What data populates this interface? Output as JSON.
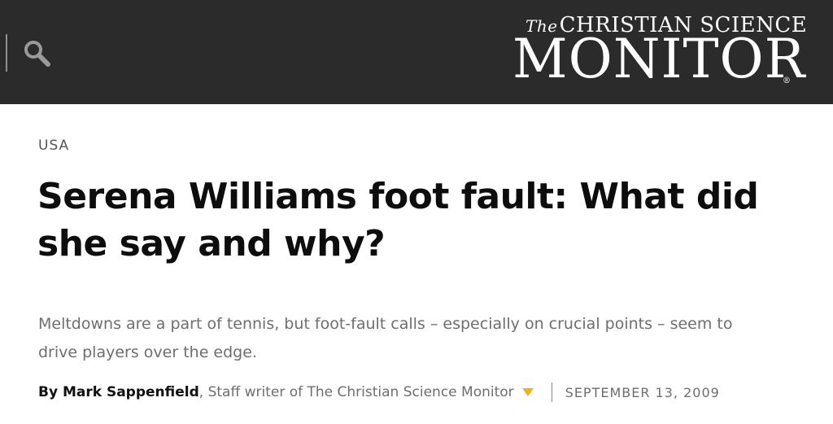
{
  "header": {
    "search_icon": "search-icon",
    "logo_the": "The",
    "logo_top": "CHRISTIAN SCIENCE",
    "logo_main": "MONITOR",
    "logo_reg": "®"
  },
  "article": {
    "section": "USA",
    "headline": "Serena Williams foot fault: What did she say and why?",
    "summary": "Meltdowns are a part of tennis, but foot-fault calls – especially on crucial points – seem to drive players over the edge.",
    "byline": {
      "by": "By Mark Sappenfield",
      "role": ", Staff writer of The Christian Science Monitor",
      "date": "SEPTEMBER 13, 2009"
    }
  },
  "colors": {
    "topbar": "#2b2b2b",
    "accent_caret": "#f0b11f"
  }
}
